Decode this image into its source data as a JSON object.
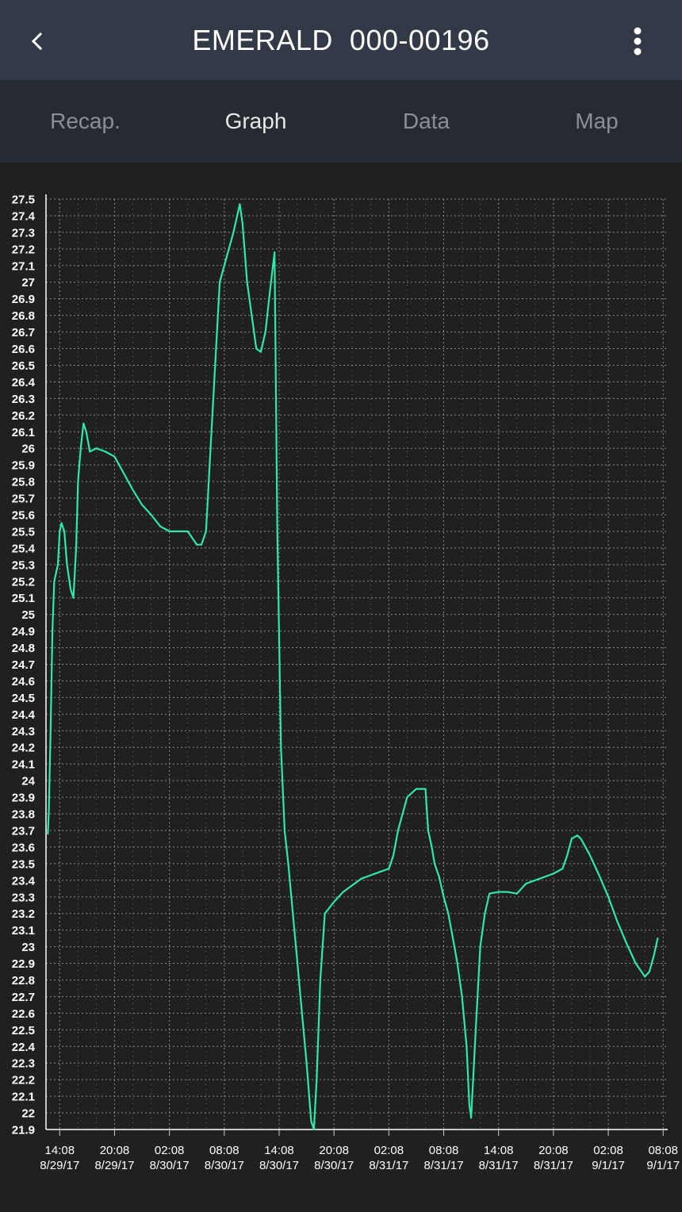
{
  "header": {
    "title": "EMERALD  000-00196",
    "back_icon": "arrow-left-icon",
    "menu_icon": "more-vertical-icon"
  },
  "tabs": [
    {
      "label": "Recap.",
      "active": false
    },
    {
      "label": "Graph",
      "active": true
    },
    {
      "label": "Data",
      "active": false
    },
    {
      "label": "Map",
      "active": false
    }
  ],
  "colors": {
    "app_bar": "#313a46",
    "tab_bar": "#262a31",
    "background": "#202020",
    "series": "#2ee8ae",
    "grid": "#8a8a8a",
    "tick_text": "#ffffff"
  },
  "chart_data": {
    "type": "line",
    "ylim": [
      21.9,
      27.5
    ],
    "y_step": 0.1,
    "y_ticks": [
      "27.5",
      "27.4",
      "27.3",
      "27.2",
      "27.1",
      "27",
      "26.9",
      "26.8",
      "26.7",
      "26.6",
      "26.5",
      "26.4",
      "26.3",
      "26.2",
      "26.1",
      "26",
      "25.9",
      "25.8",
      "25.7",
      "25.6",
      "25.5",
      "25.4",
      "25.3",
      "25.2",
      "25.1",
      "25",
      "24.9",
      "24.8",
      "24.7",
      "24.6",
      "24.5",
      "24.4",
      "24.3",
      "24.2",
      "24.1",
      "24",
      "23.9",
      "23.8",
      "23.7",
      "23.6",
      "23.5",
      "23.4",
      "23.3",
      "23.2",
      "23.1",
      "23",
      "22.9",
      "22.8",
      "22.7",
      "22.6",
      "22.5",
      "22.4",
      "22.3",
      "22.2",
      "22.1",
      "22",
      "21.9"
    ],
    "x_unit": "hours since first tick (14:08 8/29/17)",
    "xlim": [
      -1.5,
      66.5
    ],
    "x_ticks": [
      {
        "h": 0,
        "time": "14:08",
        "date": "8/29/17"
      },
      {
        "h": 6,
        "time": "20:08",
        "date": "8/29/17"
      },
      {
        "h": 12,
        "time": "02:08",
        "date": "8/30/17"
      },
      {
        "h": 18,
        "time": "08:08",
        "date": "8/30/17"
      },
      {
        "h": 24,
        "time": "14:08",
        "date": "8/30/17"
      },
      {
        "h": 30,
        "time": "20:08",
        "date": "8/30/17"
      },
      {
        "h": 36,
        "time": "02:08",
        "date": "8/31/17"
      },
      {
        "h": 42,
        "time": "08:08",
        "date": "8/31/17"
      },
      {
        "h": 48,
        "time": "14:08",
        "date": "8/31/17"
      },
      {
        "h": 54,
        "time": "20:08",
        "date": "8/31/17"
      },
      {
        "h": 60,
        "time": "02:08",
        "date": "9/1/17"
      },
      {
        "h": 66,
        "time": "08:08",
        "date": "9/1/17"
      }
    ],
    "series": [
      {
        "points": [
          [
            -1.3,
            23.68
          ],
          [
            -1.2,
            23.8
          ],
          [
            -1.0,
            24.3
          ],
          [
            -0.8,
            24.9
          ],
          [
            -0.6,
            25.2
          ],
          [
            -0.2,
            25.3
          ],
          [
            0.0,
            25.5
          ],
          [
            0.2,
            25.55
          ],
          [
            0.5,
            25.5
          ],
          [
            0.8,
            25.3
          ],
          [
            1.2,
            25.15
          ],
          [
            1.5,
            25.1
          ],
          [
            1.8,
            25.4
          ],
          [
            2.0,
            25.8
          ],
          [
            2.3,
            26.0
          ],
          [
            2.6,
            26.15
          ],
          [
            2.9,
            26.1
          ],
          [
            3.3,
            25.98
          ],
          [
            4.0,
            26.0
          ],
          [
            5.0,
            25.98
          ],
          [
            6.0,
            25.95
          ],
          [
            7.0,
            25.85
          ],
          [
            8.0,
            25.75
          ],
          [
            9.0,
            25.66
          ],
          [
            10.0,
            25.6
          ],
          [
            11.0,
            25.53
          ],
          [
            12.0,
            25.5
          ],
          [
            13.0,
            25.5
          ],
          [
            14.0,
            25.5
          ],
          [
            15.0,
            25.42
          ],
          [
            15.5,
            25.42
          ],
          [
            16.0,
            25.5
          ],
          [
            16.5,
            26.0
          ],
          [
            17.0,
            26.5
          ],
          [
            17.5,
            27.0
          ],
          [
            18.0,
            27.1
          ],
          [
            18.5,
            27.2
          ],
          [
            19.0,
            27.3
          ],
          [
            19.7,
            27.47
          ],
          [
            20.0,
            27.35
          ],
          [
            20.5,
            27.0
          ],
          [
            21.0,
            26.8
          ],
          [
            21.5,
            26.6
          ],
          [
            22.0,
            26.58
          ],
          [
            22.5,
            26.7
          ],
          [
            23.0,
            26.95
          ],
          [
            23.5,
            27.18
          ],
          [
            23.8,
            25.5
          ],
          [
            24.2,
            24.2
          ],
          [
            24.6,
            23.7
          ],
          [
            25.0,
            23.5
          ],
          [
            25.5,
            23.2
          ],
          [
            26.0,
            22.9
          ],
          [
            26.5,
            22.6
          ],
          [
            27.0,
            22.3
          ],
          [
            27.5,
            21.95
          ],
          [
            27.8,
            21.9
          ],
          [
            28.1,
            22.2
          ],
          [
            28.5,
            22.8
          ],
          [
            29.0,
            23.2
          ],
          [
            30.0,
            23.27
          ],
          [
            31.0,
            23.33
          ],
          [
            32.0,
            23.37
          ],
          [
            33.0,
            23.41
          ],
          [
            34.0,
            23.43
          ],
          [
            35.0,
            23.45
          ],
          [
            36.0,
            23.47
          ],
          [
            36.5,
            23.55
          ],
          [
            37.0,
            23.7
          ],
          [
            38.0,
            23.9
          ],
          [
            39.0,
            23.95
          ],
          [
            40.0,
            23.95
          ],
          [
            40.3,
            23.7
          ],
          [
            40.7,
            23.6
          ],
          [
            41.0,
            23.5
          ],
          [
            41.5,
            23.42
          ],
          [
            42.0,
            23.3
          ],
          [
            42.5,
            23.2
          ],
          [
            43.0,
            23.05
          ],
          [
            43.5,
            22.9
          ],
          [
            44.0,
            22.7
          ],
          [
            44.5,
            22.4
          ],
          [
            44.8,
            22.05
          ],
          [
            45.0,
            21.97
          ],
          [
            45.5,
            22.5
          ],
          [
            46.0,
            23.0
          ],
          [
            46.5,
            23.2
          ],
          [
            47.0,
            23.32
          ],
          [
            48.0,
            23.33
          ],
          [
            49.0,
            23.33
          ],
          [
            50.0,
            23.32
          ],
          [
            51.0,
            23.38
          ],
          [
            52.0,
            23.4
          ],
          [
            53.0,
            23.42
          ],
          [
            54.0,
            23.44
          ],
          [
            55.0,
            23.47
          ],
          [
            55.5,
            23.55
          ],
          [
            56.0,
            23.65
          ],
          [
            56.6,
            23.67
          ],
          [
            57.0,
            23.65
          ],
          [
            58.0,
            23.55
          ],
          [
            59.0,
            23.43
          ],
          [
            60.0,
            23.3
          ],
          [
            61.0,
            23.15
          ],
          [
            62.0,
            23.02
          ],
          [
            63.0,
            22.9
          ],
          [
            64.0,
            22.82
          ],
          [
            64.5,
            22.85
          ],
          [
            65.0,
            22.95
          ],
          [
            65.4,
            23.05
          ]
        ]
      }
    ]
  }
}
